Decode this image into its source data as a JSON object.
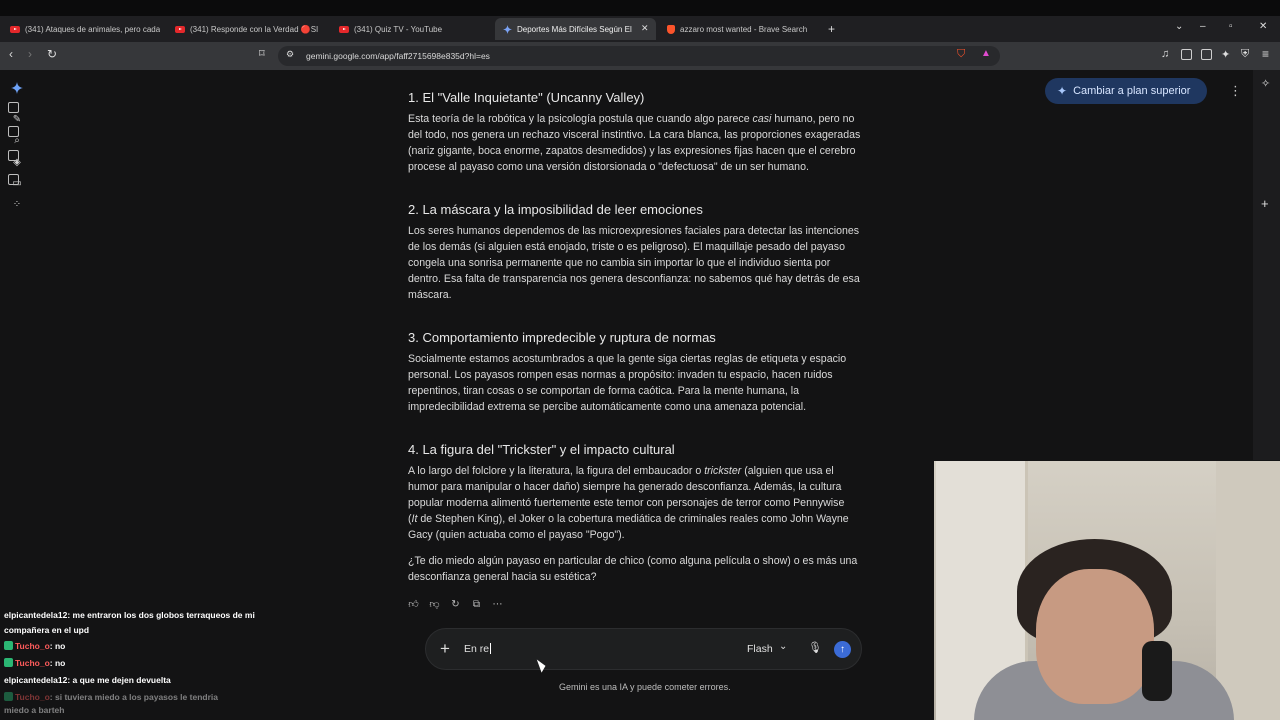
{
  "browser": {
    "tabs": [
      {
        "title": "(341) Ataques de animales, pero cada",
        "icon": "youtube-icon",
        "active": false
      },
      {
        "title": "(341) Responde con la Verdad 🔴SI",
        "icon": "youtube-icon",
        "active": false
      },
      {
        "title": "(341) Quiz TV - YouTube",
        "icon": "youtube-icon",
        "active": false
      },
      {
        "title": "Deportes Más Difíciles Según El",
        "icon": "gemini-icon",
        "active": true
      },
      {
        "title": "azzaro most wanted - Brave Search",
        "icon": "brave-icon",
        "active": false
      }
    ],
    "new_tab_label": "+",
    "url": "gemini.google.com/app/faff2715698e835d?hl=es"
  },
  "header": {
    "upgrade_label": "Cambiar a plan superior"
  },
  "sections": [
    {
      "heading": "1. El \"Valle Inquietante\" (Uncanny Valley)",
      "lines": [
        [
          "Esta teoría de la robótica y la psicología postula que cuando algo parece ",
          "casi",
          " humano, pero no"
        ],
        [
          "del todo, nos genera un rechazo visceral instintivo. La cara blanca, las proporciones exageradas"
        ],
        [
          "(nariz gigante, boca enorme, zapatos desmedidos) y las expresiones fijas hacen que el cerebro"
        ],
        [
          "procese al payaso como una versión distorsionada o \"defectuosa\" de un ser humano."
        ]
      ]
    },
    {
      "heading": "2. La máscara y la imposibilidad de leer emociones",
      "lines": [
        [
          "Los seres humanos dependemos de las microexpresiones faciales para detectar las intenciones"
        ],
        [
          "de los demás (si alguien está enojado, triste o es peligroso). El maquillaje pesado del payaso"
        ],
        [
          "congela una sonrisa permanente que no cambia sin importar lo que el individuo sienta por"
        ],
        [
          "dentro. Esa falta de transparencia nos genera desconfianza: no sabemos qué hay detrás de esa"
        ],
        [
          "máscara."
        ]
      ]
    },
    {
      "heading": "3. Comportamiento impredecible y ruptura de normas",
      "lines": [
        [
          "Socialmente estamos acostumbrados a que la gente siga ciertas reglas de etiqueta y espacio"
        ],
        [
          "personal. Los payasos rompen esas normas a propósito: invaden tu espacio, hacen ruidos"
        ],
        [
          "repentinos, tiran cosas o se comportan de forma caótica. Para la mente humana, la"
        ],
        [
          "impredecibilidad extrema se percibe automáticamente como una amenaza potencial."
        ]
      ]
    },
    {
      "heading": "4. La figura del \"Trickster\" y el impacto cultural",
      "lines": [
        [
          "A lo largo del folclore y la literatura, la figura del embaucador o ",
          "trickster",
          " (alguien que usa el"
        ],
        [
          "humor para manipular o hacer daño) siempre ha generado desconfianza. Además, la cultura"
        ],
        [
          "popular moderna alimentó fuertemente este temor con personajes de terror como Pennywise"
        ],
        [
          "(",
          "It",
          " de Stephen King), el Joker o la cobertura mediática de criminales reales como John Wayne"
        ],
        [
          "Gacy (quien actuaba como el payaso \"Pogo\")."
        ]
      ]
    }
  ],
  "closing_question": [
    "¿Te dio miedo algún payaso en particular de chico (como alguna película o show) o es más una",
    "desconfianza general hacia su estética?"
  ],
  "composer": {
    "input_value": "En re",
    "model_label": "Flash",
    "disclaimer": "Gemini es una IA y puede cometer errores."
  },
  "stream_chat": [
    {
      "user": "elpicantedela12",
      "text": ": me entraron los dos globos terraqueos de mi"
    },
    {
      "user": "",
      "text": "compañera en el upd"
    },
    {
      "user": "Tucho_o",
      "text": ": no"
    },
    {
      "user": "Tucho_o",
      "text": ": no"
    },
    {
      "user": "elpicantedela12",
      "text": ": a que me dejen devuelta"
    },
    {
      "user": "Tucho_o",
      "text": ": si tuviera miedo a los payasos le tendria"
    },
    {
      "user": "",
      "text": "miedo a barteh"
    }
  ],
  "colors": {
    "background": "#131314",
    "upgrade_bg": "#1f3760",
    "send_button": "#3b6bd6",
    "chat_user": "#ff5c5c"
  }
}
